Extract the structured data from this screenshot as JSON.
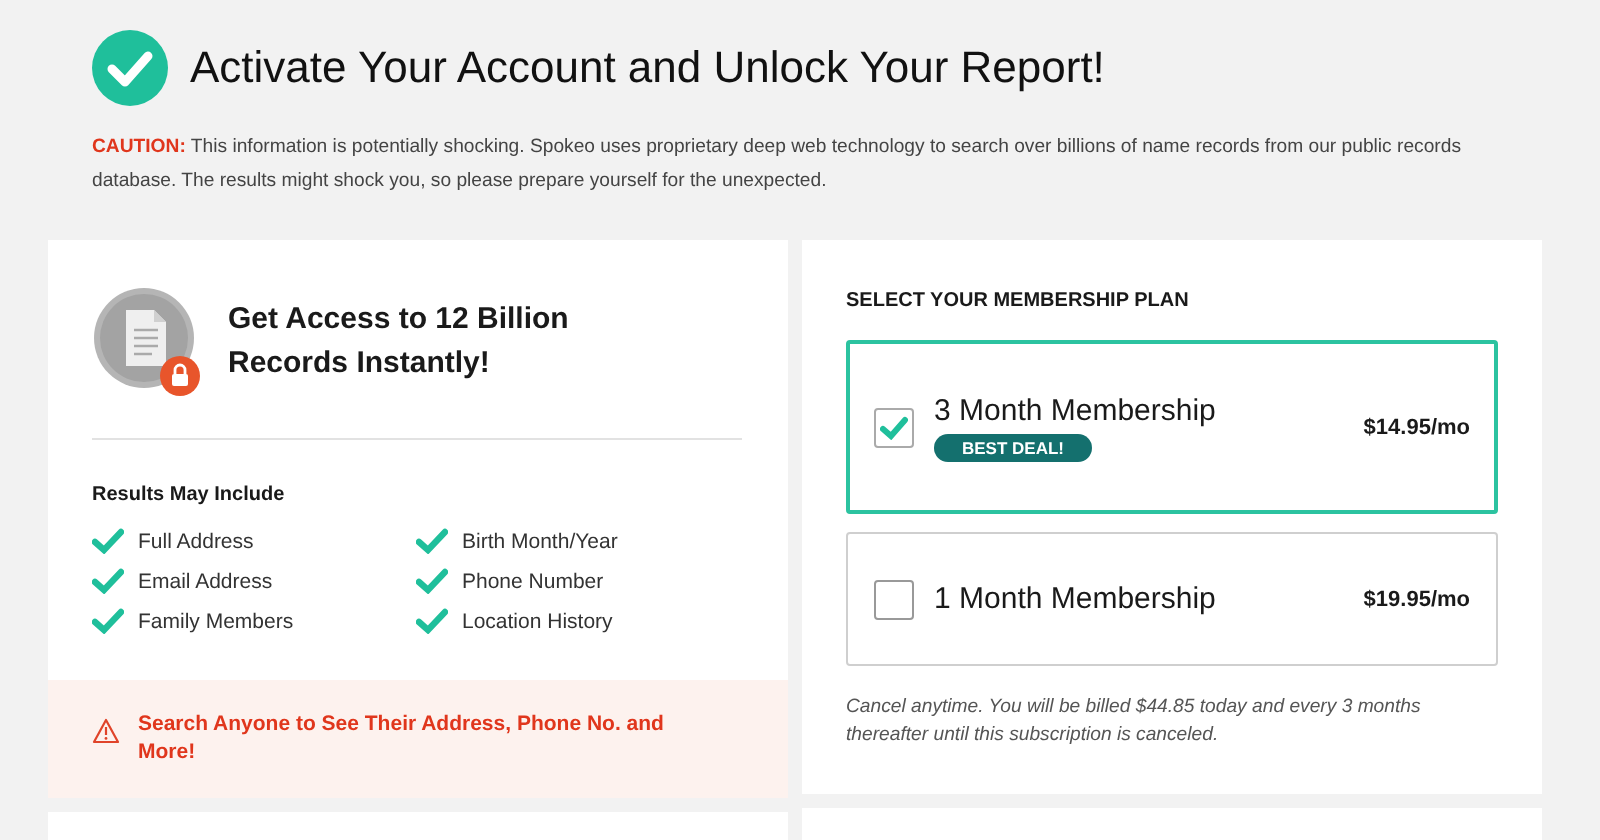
{
  "header": {
    "title": "Activate Your Account and Unlock Your Report!",
    "caution": "**CAUTION:** This information is potentially shocking. Spokeo uses proprietary deep web technology to search over billions of name records from our public records database. The results might shock you, so please prepare yourself for the unexpected."
  },
  "access_card": {
    "heading": "Get Access to 12 Billion Records Instantly!",
    "results_title": "Results May Include",
    "results": [
      "Full Address",
      "Birth Month/Year",
      "Email Address",
      "Phone Number",
      "Family Members",
      "Location History"
    ],
    "alert": "Search Anyone to See Their Address, Phone No. and More!"
  },
  "plan_card": {
    "title": "SELECT YOUR MEMBERSHIP PLAN",
    "plans": [
      {
        "name": "3 Month Membership",
        "badge": "BEST DEAL!",
        "price": "$14.95/mo",
        "selected": true
      },
      {
        "name": "1 Month Membership",
        "price": "$19.95/mo",
        "selected": false
      }
    ],
    "note": "Cancel anytime. You will be billed $44.85 today and every 3 months thereafter until this subscription is canceled."
  }
}
